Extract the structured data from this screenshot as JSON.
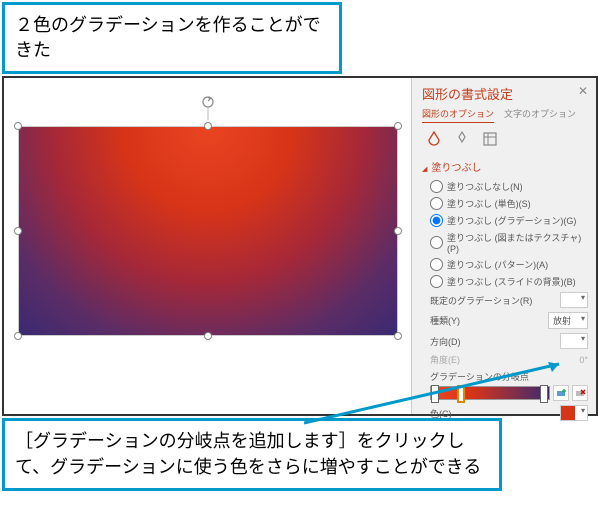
{
  "callouts": {
    "top": "２色のグラデーションを作ることができた",
    "bottom": "［グラデーションの分岐点を追加します］をクリックして、グラデーションに使う色をさらに増やすことができる"
  },
  "pane": {
    "title": "図形の書式設定",
    "tabs": {
      "shape": "図形のオプション",
      "text": "文字のオプション"
    },
    "section_fill": "塗りつぶし",
    "fill_options": {
      "none": "塗りつぶしなし(N)",
      "solid": "塗りつぶし (単色)(S)",
      "gradient": "塗りつぶし (グラデーション)(G)",
      "picture": "塗りつぶし (図またはテクスチャ)(P)",
      "pattern": "塗りつぶし (パターン)(A)",
      "slide": "塗りつぶし (スライドの背景)(B)"
    },
    "props": {
      "preset_label": "既定のグラデーション(R)",
      "type_label": "種類(Y)",
      "type_value": "放射",
      "direction_label": "方向(D)",
      "angle_label": "角度(E)",
      "angle_value": "0°",
      "stops_label": "グラデーションの分岐点",
      "color_label": "色(C)"
    }
  }
}
